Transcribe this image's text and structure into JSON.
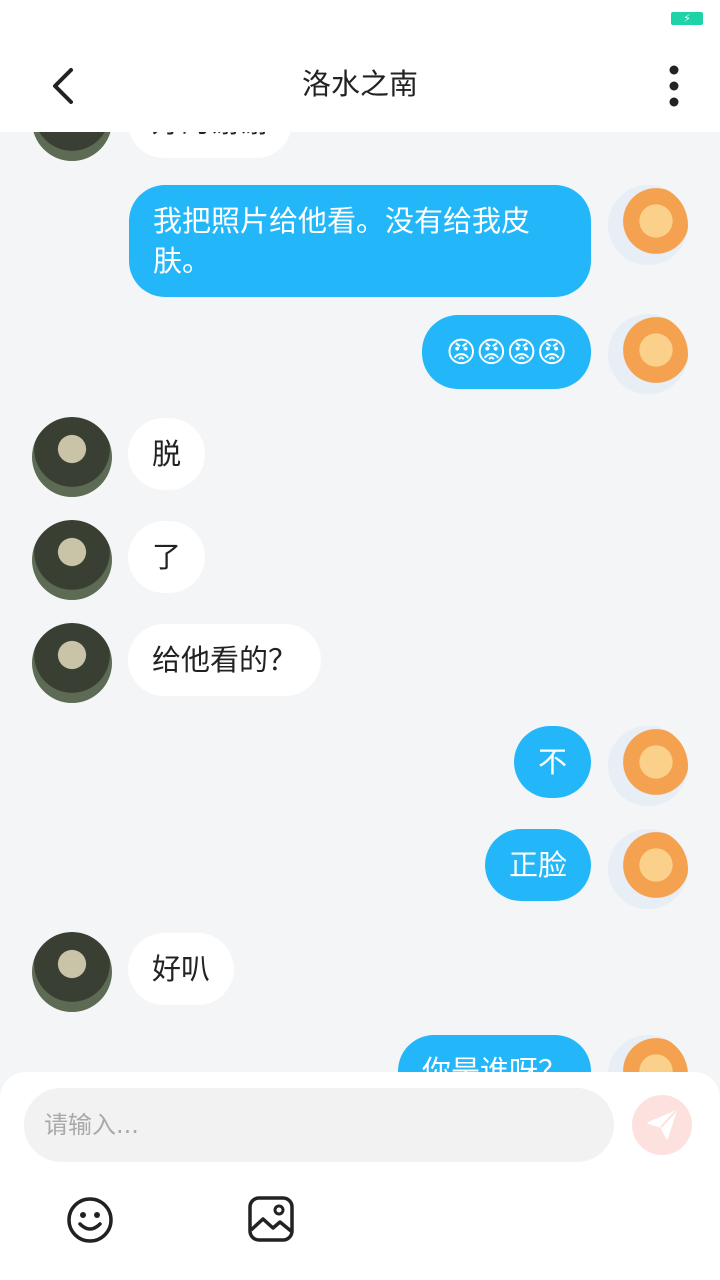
{
  "status_bar": {
    "battery_icon": "battery-charging-icon",
    "battery_color": "#1fd3a8"
  },
  "header": {
    "title": "洛水之南",
    "back_icon": "chevron-left-icon",
    "more_icon": "more-vertical-icon"
  },
  "colors": {
    "bubble_me": "#23b7fa",
    "bubble_other": "#ffffff",
    "background": "#f3f5f7"
  },
  "messages": [
    {
      "sender": "other",
      "text": "好的谢谢"
    },
    {
      "sender": "me",
      "text": "我把照片给他看。没有给我皮肤。"
    },
    {
      "sender": "me",
      "text": "😡😡😡😡"
    },
    {
      "sender": "other",
      "text": "脱"
    },
    {
      "sender": "other",
      "text": "了"
    },
    {
      "sender": "other",
      "text": "给他看的？"
    },
    {
      "sender": "me",
      "text": "不"
    },
    {
      "sender": "me",
      "text": "正脸"
    },
    {
      "sender": "other",
      "text": "好叭"
    },
    {
      "sender": "me",
      "text": "你是谁呀？"
    }
  ],
  "composer": {
    "placeholder": "请输入...",
    "send_icon": "send-icon",
    "emoji_icon": "smiley-icon",
    "image_icon": "image-icon"
  }
}
